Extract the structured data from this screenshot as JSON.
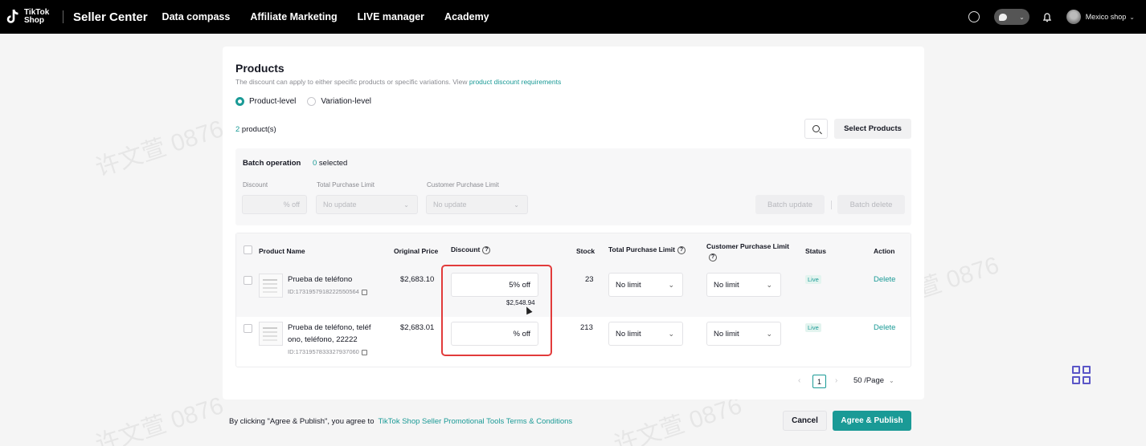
{
  "topbar": {
    "logo_text": "TikTok Shop",
    "app_title": "Seller Center",
    "nav": [
      "Data compass",
      "Affiliate Marketing",
      "LIVE manager",
      "Academy"
    ],
    "shop_name": "Mexico shop"
  },
  "products": {
    "title": "Products",
    "subtitle": "The discount can apply to either specific products or specific variations. View",
    "subtitle_link": "product discount requirements",
    "levels": [
      "Product-level",
      "Variation-level"
    ],
    "selected_level": "Product-level",
    "count_num": "2",
    "count_suffix": " product(s)",
    "select_button": "Select Products"
  },
  "batch": {
    "label": "Batch operation",
    "selected_num": "0",
    "selected_suffix": " selected",
    "discount_label": "Discount",
    "discount_placeholder": "% off",
    "total_limit_label": "Total Purchase Limit",
    "total_limit_value": "No update",
    "customer_limit_label": "Customer Purchase Limit",
    "customer_limit_value": "No update",
    "update_button": "Batch update",
    "delete_button": "Batch delete"
  },
  "table": {
    "headers": {
      "product_name": "Product Name",
      "original_price": "Original Price",
      "discount": "Discount",
      "stock": "Stock",
      "total_limit": "Total Purchase Limit",
      "customer_limit": "Customer Purchase Limit",
      "status": "Status",
      "action": "Action"
    },
    "rows": [
      {
        "name": "Prueba de teléfono",
        "id": "ID:1731957918222550564",
        "price": "$2,683.10",
        "discount": "5% off",
        "discounted_price": "$2,548.94",
        "stock": "23",
        "total_limit": "No limit",
        "customer_limit": "No limit",
        "status": "Live",
        "action": "Delete"
      },
      {
        "name_line1": "Prueba de teléfono, teléf",
        "name_line2": "ono, teléfono, 22222",
        "id": "ID:1731957833327937060",
        "price": "$2,683.01",
        "discount": "% off",
        "stock": "213",
        "total_limit": "No limit",
        "customer_limit": "No limit",
        "status": "Live",
        "action": "Delete"
      }
    ]
  },
  "pagination": {
    "current": "1",
    "page_size": "50 /Page"
  },
  "footer": {
    "agree_text": "By clicking \"Agree & Publish\", you agree to",
    "terms_link": "TikTok Shop Seller Promotional Tools Terms & Conditions",
    "cancel": "Cancel",
    "publish": "Agree & Publish"
  },
  "watermark": "许文萱 0876",
  "colors": {
    "accent": "#1a9a96",
    "highlight": "#e23b3b",
    "topbar": "#000000"
  }
}
